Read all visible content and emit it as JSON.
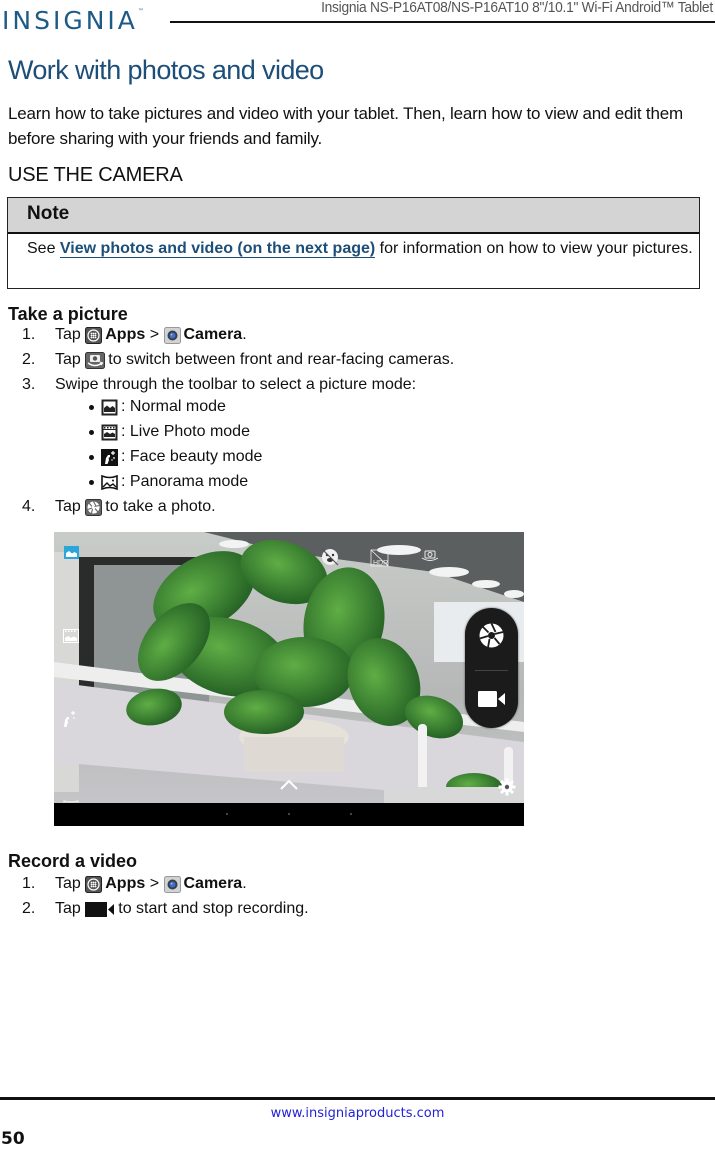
{
  "header": {
    "brand": "INSIGNIA",
    "brand_mark": "™",
    "doc_title": "Insignia  NS-P16AT08/NS-P16AT10  8\"/10.1\" Wi-Fi Android™ Tablet"
  },
  "page_title": "Work with photos and video",
  "intro": "Learn how to take pictures and video with your tablet. Then, learn how to view and edit them before sharing with your friends and family.",
  "section_heading": "USE THE CAMERA",
  "note": {
    "heading": "Note",
    "prefix": "See ",
    "link_text": "View photos and video (on the next page)",
    "suffix": " for information on how to view your pictures."
  },
  "take_picture": {
    "heading": "Take a picture",
    "steps": [
      {
        "num": "1.",
        "tap": "Tap",
        "apps_label": "Apps",
        "sep": ">",
        "camera_label": "Camera",
        "end": "."
      },
      {
        "num": "2.",
        "tap": "Tap",
        "text": "to switch between front and rear-facing cameras."
      },
      {
        "num": "3.",
        "text": "Swipe through the toolbar to select a picture mode:"
      },
      {
        "num": "4.",
        "tap": "Tap",
        "text": "to take a photo."
      }
    ],
    "modes": [
      {
        "icon": "normal-mode-icon",
        "label": ": Normal mode"
      },
      {
        "icon": "live-photo-mode-icon",
        "label": ": Live Photo mode"
      },
      {
        "icon": "face-beauty-mode-icon",
        "label": ": Face beauty mode"
      },
      {
        "icon": "panorama-mode-icon",
        "label": ": Panorama mode"
      }
    ]
  },
  "camera_screen": {
    "hdr_label": "HDR",
    "accent_color": "#2aa7d8"
  },
  "record_video": {
    "heading": "Record a video",
    "steps": [
      {
        "num": "1.",
        "tap": "Tap",
        "apps_label": "Apps",
        "sep": ">",
        "camera_label": "Camera",
        "end": "."
      },
      {
        "num": "2.",
        "tap": "Tap",
        "text": "to start and stop recording."
      }
    ]
  },
  "footer": {
    "url": "www.insigniaproducts.com",
    "page_number": "50"
  }
}
